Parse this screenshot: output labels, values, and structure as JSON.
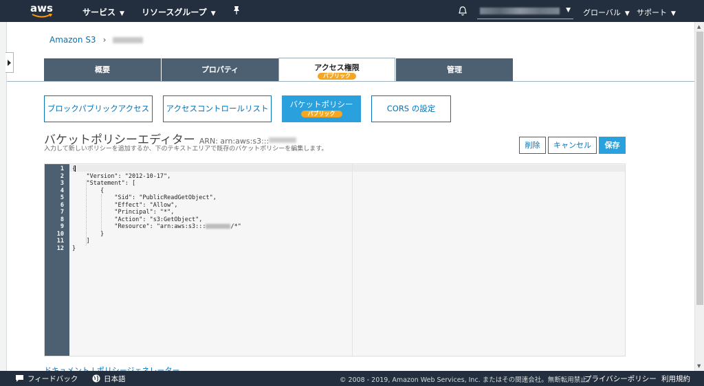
{
  "nav": {
    "logo": "aws",
    "services": "サービス",
    "resource_groups": "リソースグループ",
    "region": "グローバル",
    "support": "サポート"
  },
  "breadcrumb": {
    "root": "Amazon S3"
  },
  "tabs": [
    {
      "label": "概要"
    },
    {
      "label": "プロパティ"
    },
    {
      "label": "アクセス権限",
      "badge": "パブリック"
    },
    {
      "label": "管理"
    }
  ],
  "subtabs": [
    {
      "label": "ブロックパブリックアクセス"
    },
    {
      "label": "アクセスコントロールリスト"
    },
    {
      "label": "バケットポリシー",
      "badge": "パブリック"
    },
    {
      "label": "CORS の設定"
    }
  ],
  "editor": {
    "title": "バケットポリシーエディター",
    "arn_label": "ARN: arn:aws:s3:::",
    "description": "入力して新しいポリシーを追加するか、下のテキストエリアで既存のバケットポリシーを編集します。",
    "delete_label": "削除",
    "cancel_label": "キャンセル",
    "save_label": "保存",
    "lines": [
      "1",
      "2",
      "3",
      "4",
      "5",
      "6",
      "7",
      "8",
      "9",
      "10",
      "11",
      "12"
    ],
    "code": [
      "{",
      "    \"Version\": \"2012-10-17\",",
      "    \"Statement\": [",
      "        {",
      "            \"Sid\": \"PublicReadGetObject\",",
      "            \"Effect\": \"Allow\",",
      "            \"Principal\": \"*\",",
      "            \"Action\": \"s3:GetObject\",",
      "            \"Resource\": \"arn:aws:s3:::",
      "        }",
      "    ]",
      "}"
    ],
    "resource_suffix": "/*\""
  },
  "links": {
    "documentation": "ドキュメント",
    "generator": "ポリシージェネレーター"
  },
  "footer": {
    "feedback": "フィードバック",
    "language": "日本語",
    "copyright": "© 2008 - 2019, Amazon Web Services, Inc. またはその関連会社。無断転用禁止。",
    "privacy": "プライバシーポリシー",
    "terms": "利用規約"
  }
}
